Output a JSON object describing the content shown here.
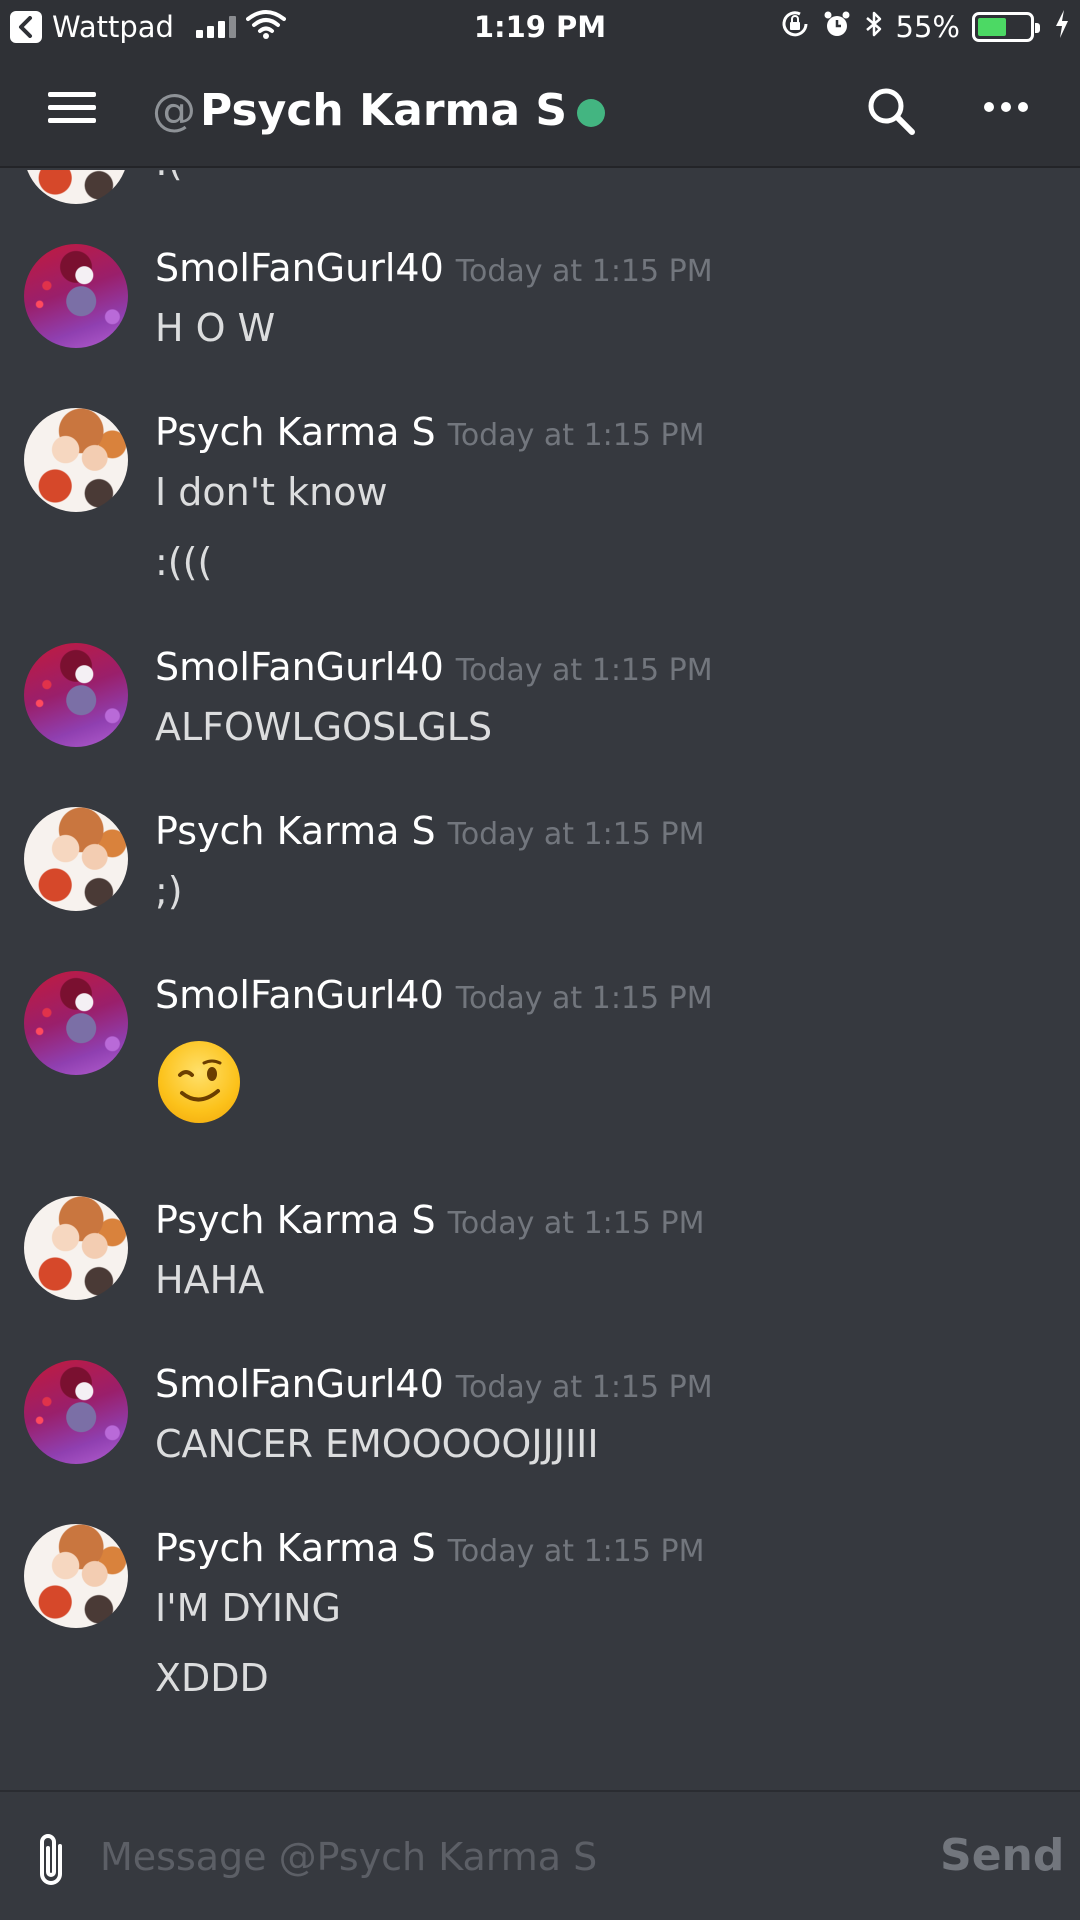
{
  "status_bar": {
    "back_app": "Wattpad",
    "time": "1:19 PM",
    "battery_percent": "55%",
    "battery_level": 0.55
  },
  "header": {
    "at": "@",
    "channel": "Psych Karma S",
    "status_color": "#43b581"
  },
  "messages": [
    {
      "author": "",
      "time": "",
      "lines": [
        ":("
      ]
    },
    {
      "author": "SmolFanGurl40",
      "time": "Today at 1:15 PM",
      "lines": [
        "H O W"
      ]
    },
    {
      "author": "Psych Karma S",
      "time": "Today at 1:15 PM",
      "lines": [
        "I don't know",
        ":((("
      ]
    },
    {
      "author": "SmolFanGurl40",
      "time": "Today at 1:15 PM",
      "lines": [
        "ALFOWLGOSLGLS"
      ]
    },
    {
      "author": "Psych Karma S",
      "time": "Today at 1:15 PM",
      "lines": [
        ";)"
      ]
    },
    {
      "author": "SmolFanGurl40",
      "time": "Today at 1:15 PM",
      "emoji": "wink-emoji"
    },
    {
      "author": "Psych Karma S",
      "time": "Today at 1:15 PM",
      "lines": [
        "HAHA"
      ]
    },
    {
      "author": "SmolFanGurl40",
      "time": "Today at 1:15 PM",
      "lines": [
        "CANCER EMOOOOOJJJIII"
      ]
    },
    {
      "author": "Psych Karma S",
      "time": "Today at 1:15 PM",
      "lines": [
        "I'M DYING",
        "XDDD"
      ]
    }
  ],
  "composer": {
    "placeholder": "Message @Psych Karma S",
    "send_label": "Send"
  },
  "colors": {
    "background": "#36393f",
    "header": "#2f3136",
    "online": "#43b581",
    "timestamp": "#72767d"
  }
}
